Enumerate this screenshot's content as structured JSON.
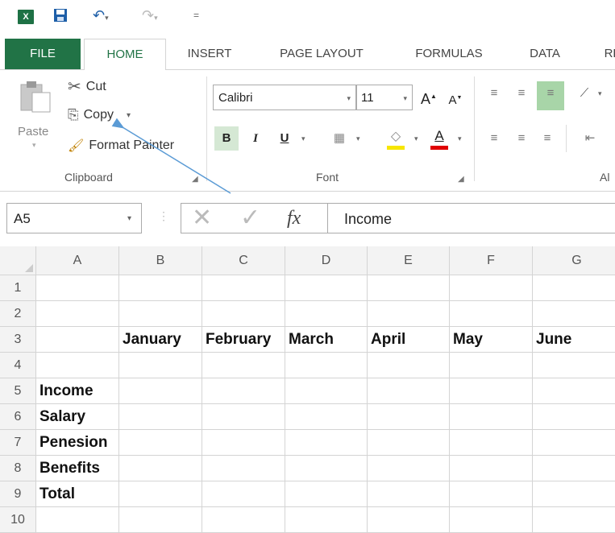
{
  "qat": {
    "app_icon": "X",
    "redo_icon": "redo-icon",
    "customize": "="
  },
  "tabs": [
    "FILE",
    "HOME",
    "INSERT",
    "PAGE LAYOUT",
    "FORMULAS",
    "DATA",
    "RE"
  ],
  "clipboard": {
    "paste": "Paste",
    "cut": "Cut",
    "copy": "Copy",
    "format_painter": "Format Painter",
    "group": "Clipboard"
  },
  "font": {
    "name": "Calibri",
    "size": "11",
    "bold": "B",
    "italic": "I",
    "underline": "U",
    "grow": "A",
    "shrink": "A",
    "color_letter": "A",
    "group": "Font"
  },
  "alignment": {
    "group": "Al"
  },
  "formula_bar": {
    "name_box": "A5",
    "fx": "fx",
    "content": "Income"
  },
  "grid": {
    "columns": [
      "A",
      "B",
      "C",
      "D",
      "E",
      "F",
      "G"
    ],
    "rows": [
      "1",
      "2",
      "3",
      "4",
      "5",
      "6",
      "7",
      "8",
      "9",
      "10"
    ],
    "months": [
      "January",
      "February",
      "March",
      "April",
      "May",
      "June"
    ],
    "labels": [
      "Income",
      "Salary",
      "Penesion",
      "Benefits",
      "Total"
    ]
  },
  "colors": {
    "excel_green": "#217346",
    "highlight": "#f7e600",
    "font_red": "#e00000",
    "arrow": "#5b9bd5"
  }
}
